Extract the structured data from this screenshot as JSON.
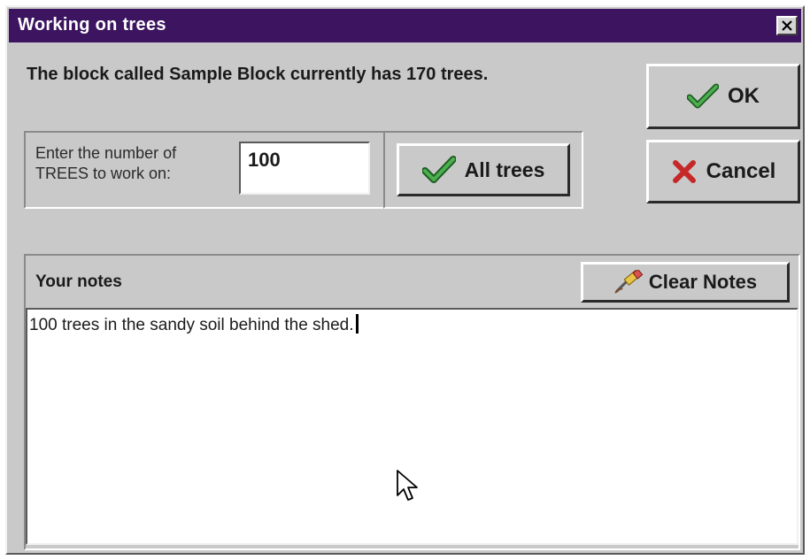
{
  "window": {
    "title": "Working on trees",
    "close_icon": "close-icon"
  },
  "info": {
    "message": "The block called Sample Block currently has 170 trees."
  },
  "tree_count": {
    "prompt_line1": "Enter the number of",
    "prompt_line2": "TREES to work on:",
    "value": "100"
  },
  "buttons": {
    "all_trees_label": "All trees",
    "all_trees_icon": "checkmark-icon",
    "ok_label": "OK",
    "ok_icon": "checkmark-icon",
    "cancel_label": "Cancel",
    "cancel_icon": "x-icon",
    "clear_notes_label": "Clear Notes",
    "clear_notes_icon": "eraser-icon"
  },
  "notes": {
    "label": "Your notes",
    "content": "100 trees in the sandy soil behind the shed."
  },
  "colors": {
    "title_bar": "#3c1460",
    "window_bg": "#c9c9c9",
    "check_green": "#2e7d32",
    "cancel_red": "#c62828"
  }
}
